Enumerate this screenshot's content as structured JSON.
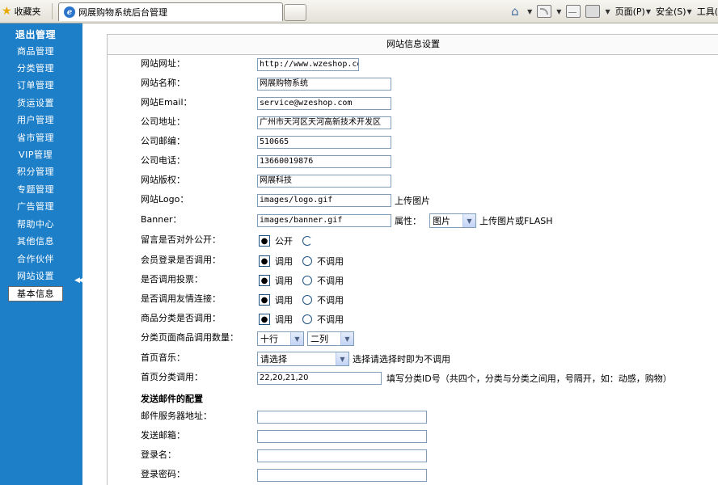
{
  "browser": {
    "favorites_label": "收藏夹",
    "tab_title": "网展购物系统后台管理",
    "menu_page": "页面(P)",
    "menu_safety": "安全(S)",
    "menu_tools": "工具("
  },
  "sidebar": {
    "logout": "退出管理",
    "items": [
      "商品管理",
      "分类管理",
      "订单管理",
      "货运设置",
      "用户管理",
      "省市管理",
      "VIP管理",
      "积分管理",
      "专题管理",
      "广告管理",
      "帮助中心",
      "其他信息",
      "合作伙伴",
      "网站设置",
      "基本信息"
    ],
    "collapse_icon": "double-left-chevron"
  },
  "main": {
    "title": "网站信息设置",
    "fields": [
      {
        "label": "网站网址：",
        "value": "http://www.wzeshop.com"
      },
      {
        "label": "网站名称：",
        "value": "网展购物系统"
      },
      {
        "label": "网站Email：",
        "value": "service@wzeshop.com"
      },
      {
        "label": "公司地址：",
        "value": "广州市天河区天河高新技术开发区"
      },
      {
        "label": "公司邮编：",
        "value": "510665"
      },
      {
        "label": "公司电话：",
        "value": "13660019876"
      },
      {
        "label": "网站版权：",
        "value": "网展科技"
      },
      {
        "label": "网站Logo：",
        "value": "images/logo.gif",
        "hint": "上传图片"
      },
      {
        "label": "Banner：",
        "value": "images/banner.gif",
        "attr_label": "属性：",
        "attr_value": "图片",
        "hint": "上传图片或FLASH"
      }
    ],
    "options": [
      {
        "label": "留言是否对外公开：",
        "opt1": "公开",
        "opt2": ""
      },
      {
        "label": "会员登录是否调用：",
        "opt1": "调用",
        "opt2": "不调用"
      },
      {
        "label": "是否调用投票：",
        "opt1": "调用",
        "opt2": "不调用"
      },
      {
        "label": "是否调用友情连接：",
        "opt1": "调用",
        "opt2": "不调用"
      },
      {
        "label": "商品分类是否调用：",
        "opt1": "调用",
        "opt2": "不调用"
      }
    ],
    "category_count": {
      "label": "分类页面商品调用数量：",
      "rows": "十行",
      "cols": "二列"
    },
    "music": {
      "label": "首页音乐：",
      "value": "请选择",
      "hint": "选择请选择时即为不调用"
    },
    "home_category": {
      "label": "首页分类调用：",
      "value": "22,20,21,20",
      "hint": "填写分类ID号（共四个，分类与分类之间用，号隔开，如：动感，购物）"
    },
    "mail_section": {
      "title": "发送邮件的配置",
      "fields": [
        {
          "label": "邮件服务器地址：",
          "value": ""
        },
        {
          "label": "发送邮箱：",
          "value": ""
        },
        {
          "label": "登录名：",
          "value": ""
        },
        {
          "label": "登录密码：",
          "value": ""
        }
      ]
    }
  }
}
